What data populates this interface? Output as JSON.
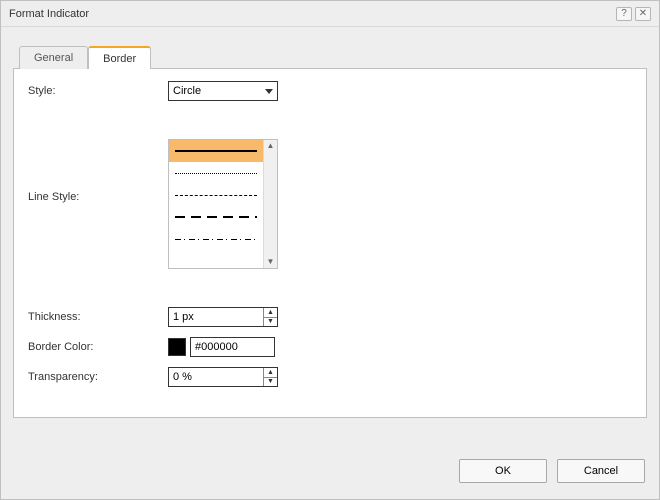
{
  "window": {
    "title": "Format Indicator",
    "help_icon": "?",
    "close_icon": "✕"
  },
  "tabs": {
    "general": "General",
    "border": "Border",
    "active": "border"
  },
  "border": {
    "style_label": "Style:",
    "style_value": "Circle",
    "line_style_label": "Line Style:",
    "line_styles": [
      {
        "selected": true,
        "border": "2px solid #000"
      },
      {
        "selected": false,
        "border": "1px dotted #000"
      },
      {
        "selected": false,
        "border": "1px dashed #000"
      },
      {
        "selected": false,
        "border": "0",
        "pattern": "long-dash"
      },
      {
        "selected": false,
        "border": "0",
        "pattern": "dash-dot"
      }
    ],
    "thickness_label": "Thickness:",
    "thickness_value": "1 px",
    "border_color_label": "Border Color:",
    "border_color_value": "#000000",
    "border_color_swatch": "#000000",
    "transparency_label": "Transparency:",
    "transparency_value": "0 %"
  },
  "buttons": {
    "ok": "OK",
    "cancel": "Cancel"
  }
}
